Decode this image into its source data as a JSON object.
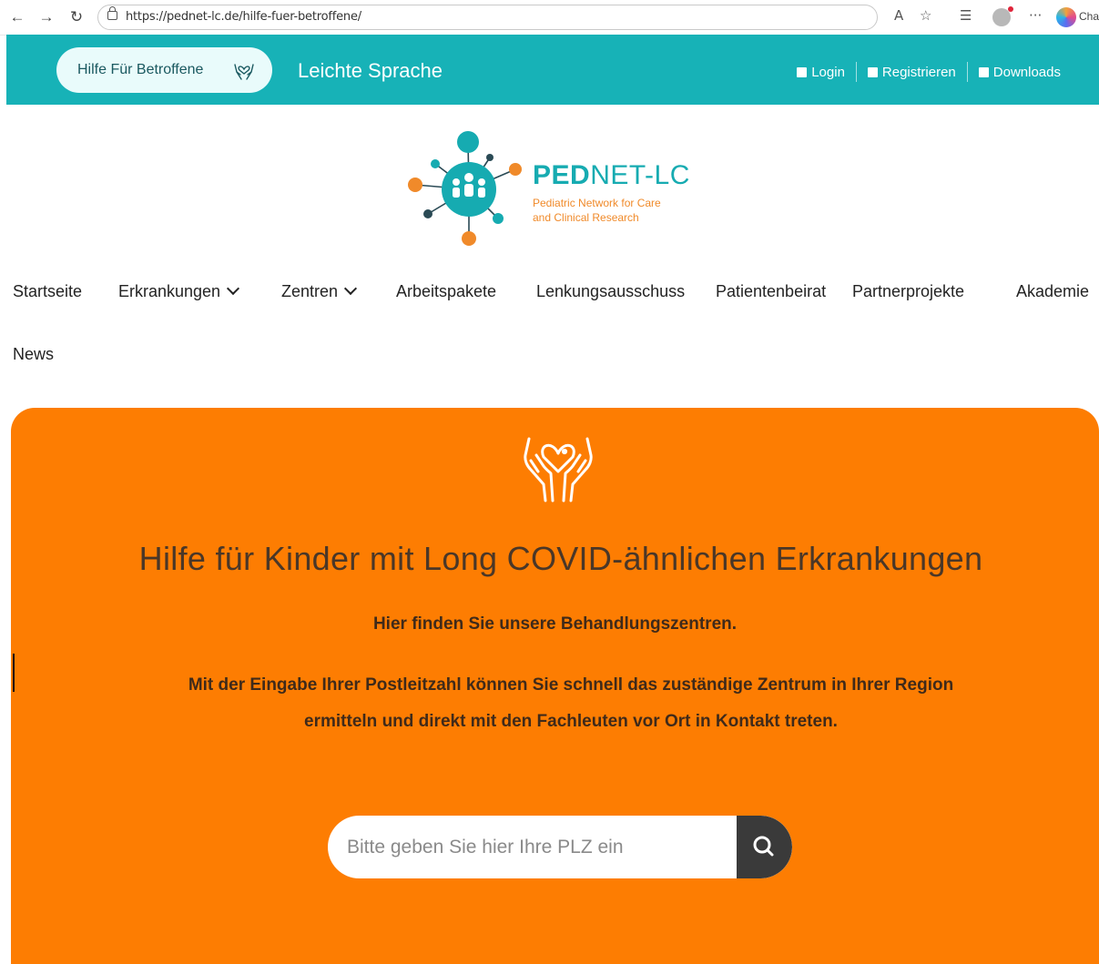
{
  "browser": {
    "url": "https://pednet-lc.de/hilfe-fuer-betroffene/",
    "profile_label": "Cha"
  },
  "topbar": {
    "pill_label": "Hilfe Für Betroffene",
    "easy_language": "Leichte Sprache",
    "links": [
      {
        "label": "Login",
        "icon": "login-icon"
      },
      {
        "label": "Registrieren",
        "icon": "register-icon"
      },
      {
        "label": "Downloads",
        "icon": "save-icon"
      }
    ]
  },
  "logo": {
    "title_bold": "PED",
    "title_rest": "NET-LC",
    "subtitle_line1": "Pediatric Network for Care",
    "subtitle_line2": "and Clinical Research"
  },
  "nav": {
    "items": [
      {
        "label": "Startseite"
      },
      {
        "label": "Erkrankungen"
      },
      {
        "label": "Zentren"
      },
      {
        "label": "Arbeitspakete"
      },
      {
        "label": "Lenkungsausschuss"
      },
      {
        "label": "Patientenbeirat"
      },
      {
        "label": "Partnerprojekte"
      },
      {
        "label": "Akademie"
      },
      {
        "label": "News"
      }
    ]
  },
  "hero": {
    "title": "Hilfe für Kinder mit Long COVID-ähnlichen Erkrankungen",
    "subtitle": "Hier finden Sie unsere Behandlungszentren.",
    "description": "Mit der Eingabe Ihrer Postleitzahl können Sie schnell das zuständige Zentrum in Ihrer Region ermitteln und direkt mit den Fachleuten vor Ort in Kontakt treten.",
    "search_placeholder": "Bitte geben Sie hier Ihre PLZ ein",
    "search_icon": "search-icon"
  },
  "colors": {
    "teal": "#17b2b7",
    "orange": "#fd7d02",
    "logo_orange": "#f08a2a",
    "dark_text": "#3f2a1a"
  }
}
